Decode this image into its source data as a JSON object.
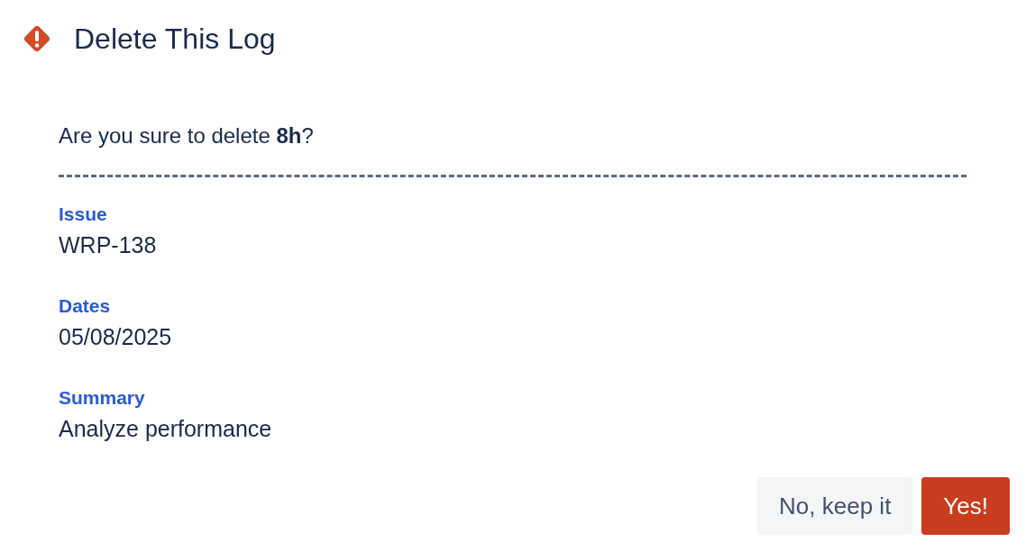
{
  "dialog": {
    "title": "Delete This Log",
    "message": "Are you sure to delete **8h**?",
    "fields": [
      {
        "label": "Issue",
        "value": "WRP-138"
      },
      {
        "label": "Dates",
        "value": "05/08/2025"
      },
      {
        "label": "Summary",
        "value": "Analyze performance"
      }
    ],
    "buttons": [
      {
        "label": "No, keep it",
        "kind": "subtle"
      },
      {
        "label": "Yes!",
        "kind": "danger"
      }
    ]
  }
}
